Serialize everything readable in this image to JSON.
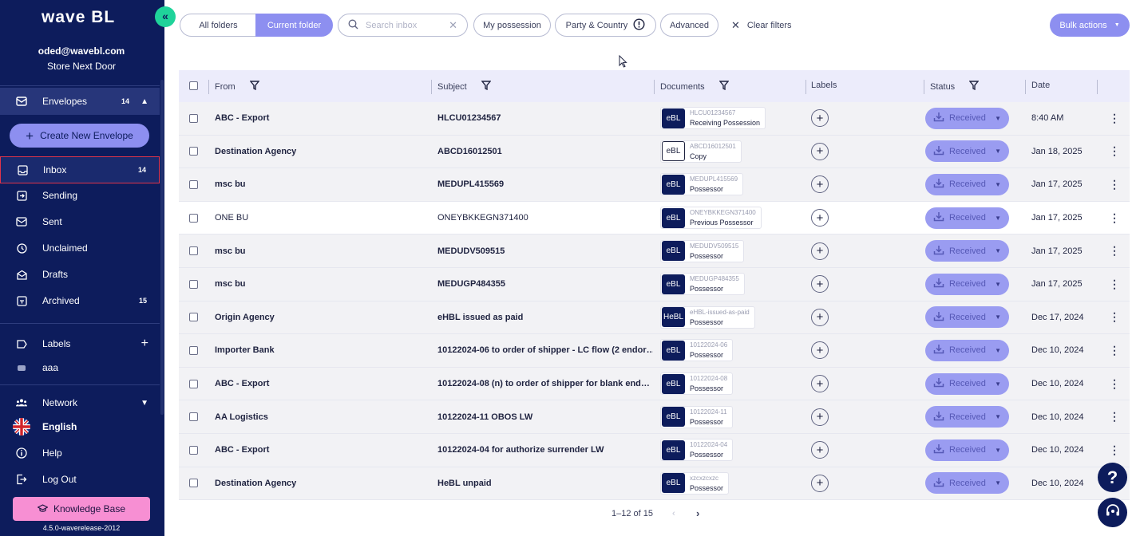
{
  "app": {
    "logo": "wave BL",
    "version": "4.5.0-waverelease-2012"
  },
  "user": {
    "email": "oded@wavebl.com",
    "store": "Store Next Door"
  },
  "sidebar": {
    "envelopes": {
      "label": "Envelopes",
      "count": "14"
    },
    "create_label": "Create New Envelope",
    "items": [
      {
        "label": "Inbox",
        "count": "14",
        "icon": "inbox-icon"
      },
      {
        "label": "Sending",
        "count": "",
        "icon": "send-icon"
      },
      {
        "label": "Sent",
        "count": "",
        "icon": "sent-icon"
      },
      {
        "label": "Unclaimed",
        "count": "",
        "icon": "clock-icon"
      },
      {
        "label": "Drafts",
        "count": "",
        "icon": "drafts-icon"
      },
      {
        "label": "Archived",
        "count": "15",
        "icon": "archive-icon"
      }
    ],
    "labels_title": "Labels",
    "labels": [
      {
        "label": "aaa"
      }
    ],
    "network": "Network",
    "language": "English",
    "help": "Help",
    "logout": "Log Out",
    "knowledge_base": "Knowledge Base"
  },
  "filters": {
    "all_folders": "All folders",
    "current_folder": "Current folder",
    "search_placeholder": "Search inbox",
    "my_possession": "My possession",
    "party_country": "Party & Country",
    "advanced": "Advanced",
    "clear": "Clear filters",
    "bulk": "Bulk actions"
  },
  "table": {
    "headers": {
      "from": "From",
      "subject": "Subject",
      "documents": "Documents",
      "labels": "Labels",
      "status": "Status",
      "date": "Date"
    },
    "rows": [
      {
        "from": "ABC - Export",
        "subject": "HLCU01234567",
        "doc_type": "eBL",
        "doc_num": "HLCU01234567",
        "doc_state": "Receiving Possession",
        "status": "Received",
        "date": "8:40 AM",
        "read": false,
        "outline": false
      },
      {
        "from": "Destination Agency",
        "subject": "ABCD16012501",
        "doc_type": "eBL",
        "doc_num": "ABCD16012501",
        "doc_state": "Copy",
        "status": "Received",
        "date": "Jan 18, 2025",
        "read": false,
        "outline": true
      },
      {
        "from": "msc bu",
        "subject": "MEDUPL415569",
        "doc_type": "eBL",
        "doc_num": "MEDUPL415569",
        "doc_state": "Possessor",
        "status": "Received",
        "date": "Jan 17, 2025",
        "read": false,
        "outline": false
      },
      {
        "from": "ONE BU",
        "subject": "ONEYBKKEGN371400",
        "doc_type": "eBL",
        "doc_num": "ONEYBKKEGN371400",
        "doc_state": "Previous Possessor",
        "status": "Received",
        "date": "Jan 17, 2025",
        "read": true,
        "outline": false
      },
      {
        "from": "msc bu",
        "subject": "MEDUDV509515",
        "doc_type": "eBL",
        "doc_num": "MEDUDV509515",
        "doc_state": "Possessor",
        "status": "Received",
        "date": "Jan 17, 2025",
        "read": false,
        "outline": false
      },
      {
        "from": "msc bu",
        "subject": "MEDUGP484355",
        "doc_type": "eBL",
        "doc_num": "MEDUGP484355",
        "doc_state": "Possessor",
        "status": "Received",
        "date": "Jan 17, 2025",
        "read": false,
        "outline": false
      },
      {
        "from": "Origin Agency",
        "subject": "eHBL issued as paid",
        "doc_type": "HeBL",
        "doc_num": "eHBL-issued-as-paid",
        "doc_state": "Possessor",
        "status": "Received",
        "date": "Dec 17, 2024",
        "read": false,
        "outline": false
      },
      {
        "from": "Importer Bank",
        "subject": "10122024-06 to order of shipper - LC flow (2 endor…",
        "doc_type": "eBL",
        "doc_num": "10122024-06",
        "doc_state": "Possessor",
        "status": "Received",
        "date": "Dec 10, 2024",
        "read": false,
        "outline": false
      },
      {
        "from": "ABC - Export",
        "subject": "10122024-08 (n) to order of shipper for blank end…",
        "doc_type": "eBL",
        "doc_num": "10122024-08",
        "doc_state": "Possessor",
        "status": "Received",
        "date": "Dec 10, 2024",
        "read": false,
        "outline": false
      },
      {
        "from": "AA Logistics",
        "subject": "10122024-11 OBOS LW",
        "doc_type": "eBL",
        "doc_num": "10122024-11",
        "doc_state": "Possessor",
        "status": "Received",
        "date": "Dec 10, 2024",
        "read": false,
        "outline": false
      },
      {
        "from": "ABC - Export",
        "subject": "10122024-04 for authorize surrender LW",
        "doc_type": "eBL",
        "doc_num": "10122024-04",
        "doc_state": "Possessor",
        "status": "Received",
        "date": "Dec 10, 2024",
        "read": false,
        "outline": false
      },
      {
        "from": "Destination Agency",
        "subject": "HeBL unpaid",
        "doc_type": "eBL",
        "doc_num": "xzcxzcxzc",
        "doc_state": "Possessor",
        "status": "Received",
        "date": "Dec 10, 2024",
        "read": false,
        "outline": false
      }
    ]
  },
  "pagination": {
    "label": "1–12 of 15"
  },
  "colors": {
    "sidebar": "#0d1c5c",
    "accent": "#8d8ff0",
    "green": "#1fd39a",
    "pink": "#f78fd3"
  }
}
